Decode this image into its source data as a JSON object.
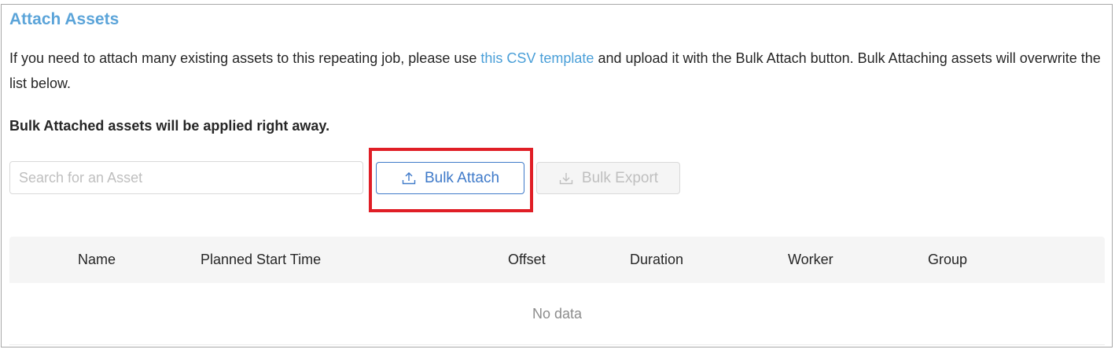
{
  "section": {
    "title": "Attach Assets",
    "description_before": "If you need to attach many existing assets to this repeating job, please use ",
    "description_link": "this CSV template",
    "description_after": " and upload it with the Bulk Attach button. Bulk Attaching assets will overwrite the list below.",
    "notice": "Bulk Attached assets will be applied right away."
  },
  "toolbar": {
    "search_placeholder": "Search for an Asset",
    "search_value": "",
    "bulk_attach_label": "Bulk Attach",
    "bulk_attach_icon": "upload-icon",
    "bulk_export_label": "Bulk Export",
    "bulk_export_icon": "download-icon",
    "bulk_export_disabled": true
  },
  "table": {
    "columns": [
      "Name",
      "Planned Start Time",
      "Offset",
      "Duration",
      "Worker",
      "Group"
    ],
    "rows": [],
    "empty_text": "No data"
  },
  "colors": {
    "title": "#5ba4d9",
    "link": "#4a9fd8",
    "primary": "#3f7ac9",
    "highlight": "#e01e26",
    "header_bg": "#f5f5f5"
  }
}
